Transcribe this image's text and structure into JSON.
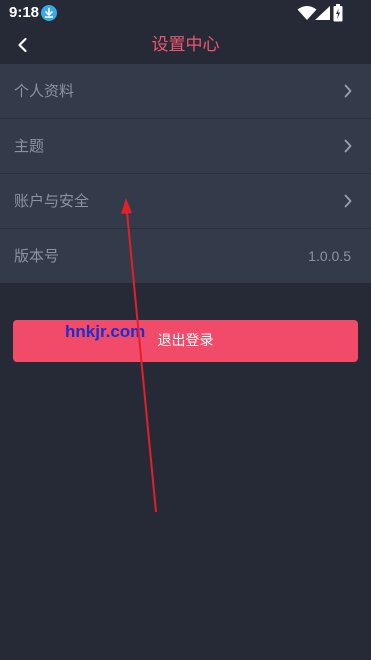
{
  "status_bar": {
    "time": "9:18",
    "icons": [
      "download-icon",
      "wifi-icon",
      "signal-icon",
      "battery-icon"
    ]
  },
  "header": {
    "title": "设置中心",
    "back_icon": "chevron-left-icon"
  },
  "menu": {
    "items": [
      {
        "label": "个人资料",
        "icon": "chevron-right-icon"
      },
      {
        "label": "主题",
        "icon": "chevron-right-icon"
      },
      {
        "label": "账户与安全",
        "icon": "chevron-right-icon"
      },
      {
        "label": "版本号",
        "value": "1.0.0.5"
      }
    ]
  },
  "logout": {
    "label": "退出登录"
  },
  "watermark": {
    "text": "hnkjr.com"
  },
  "colors": {
    "background": "#262a37",
    "panel": "#333a4a",
    "accent": "#f0566e",
    "button": "#f24b6a",
    "annotation_arrow": "#e0202a",
    "watermark": "#1a2fd0"
  }
}
